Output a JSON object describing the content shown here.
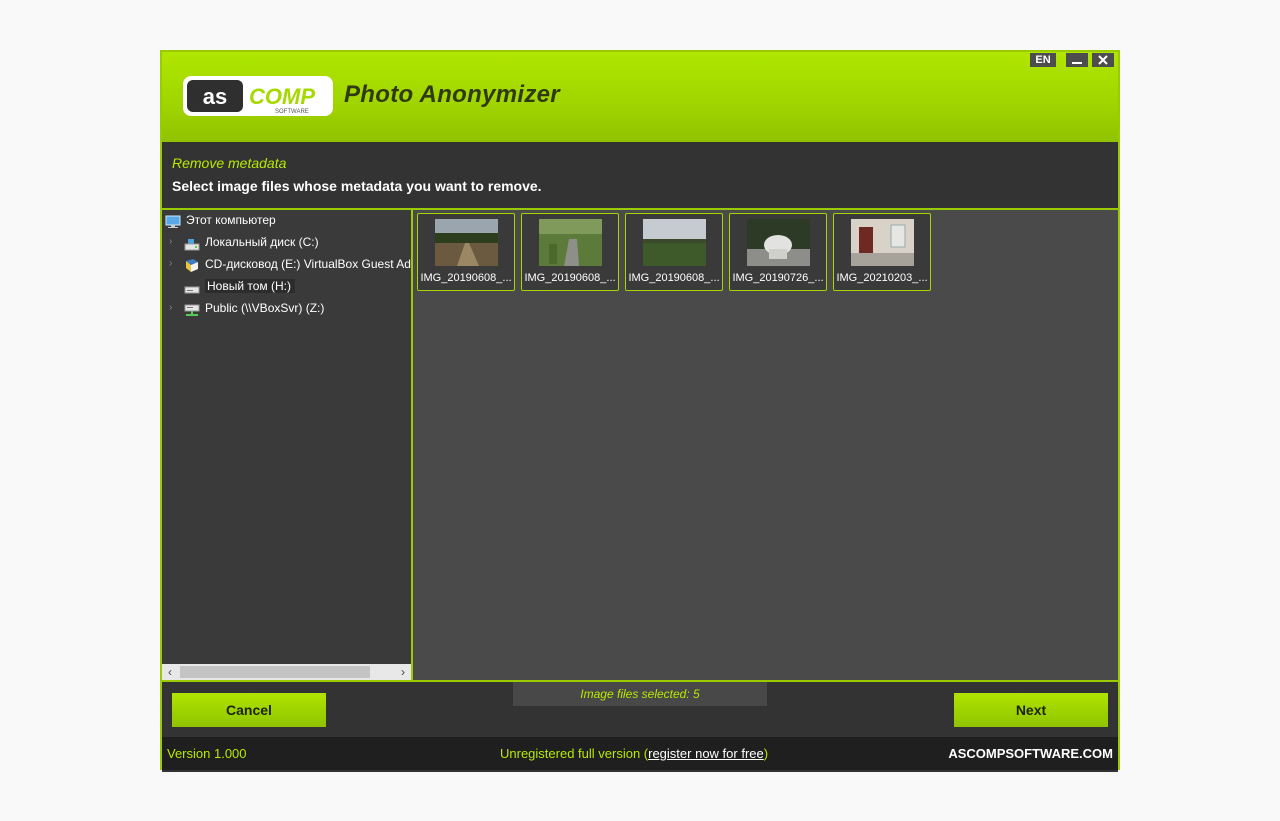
{
  "window": {
    "logo_text": "ASCOMP SOFTWARE",
    "title": "Photo Anonymizer",
    "language": "EN"
  },
  "step": {
    "title": "Remove metadata",
    "instruction": "Select image files whose metadata you want to remove."
  },
  "tree": {
    "root": "Этот компьютер",
    "items": [
      {
        "label": "Локальный диск (C:)",
        "icon": "drive-icon"
      },
      {
        "label": "CD-дисковод (E:) VirtualBox Guest Add",
        "icon": "cd-drive-icon"
      },
      {
        "label": "Новый том (H:)",
        "icon": "drive-icon"
      },
      {
        "label": "Public (\\\\VBoxSvr) (Z:)",
        "icon": "network-drive-icon"
      }
    ]
  },
  "thumbnails": [
    {
      "caption": "IMG_20190608_..."
    },
    {
      "caption": "IMG_20190608_..."
    },
    {
      "caption": "IMG_20190608_..."
    },
    {
      "caption": "IMG_20190726_..."
    },
    {
      "caption": "IMG_20210203_..."
    }
  ],
  "footer": {
    "cancel": "Cancel",
    "next": "Next",
    "selected": "Image files selected: 5",
    "version": "Version 1.000",
    "reg_prefix": "Unregistered full version (",
    "reg_link": "register now for free",
    "reg_suffix": ")",
    "site": "ASCOMPSOFTWARE.COM"
  },
  "colors": {
    "accent": "#a6d900",
    "dark": "#333333",
    "panel": "#4a4a4a"
  }
}
